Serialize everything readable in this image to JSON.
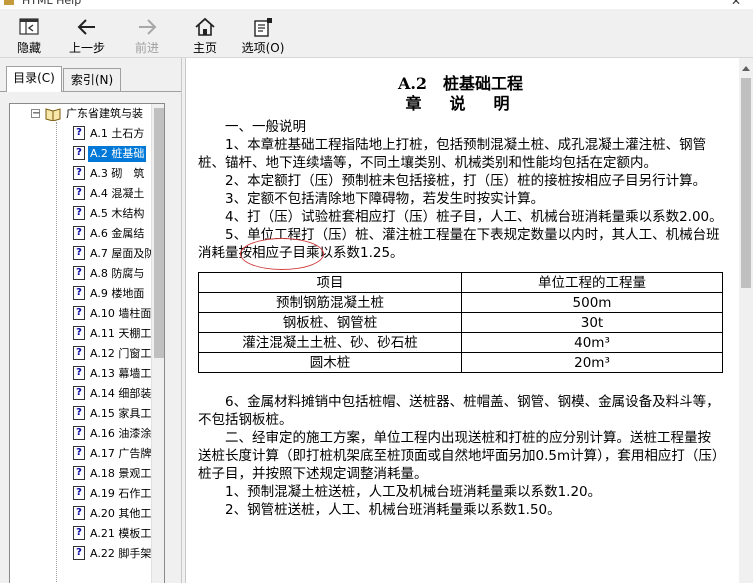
{
  "window": {
    "title": "HTML Help"
  },
  "toolbar": {
    "hide": "隐藏",
    "back": "上一步",
    "forward": "前进",
    "home": "主页",
    "options": "选项(O)"
  },
  "nav": {
    "tabs": [
      {
        "label": "目录(C)",
        "active": true
      },
      {
        "label": "索引(N)",
        "active": false
      }
    ],
    "root": {
      "label": "广东省建筑与装"
    },
    "items": [
      {
        "num": "A.1",
        "label": "土石方"
      },
      {
        "num": "A.2",
        "label": "桩基础",
        "selected": true
      },
      {
        "num": "A.3",
        "label": "砌　筑"
      },
      {
        "num": "A.4",
        "label": "混凝土"
      },
      {
        "num": "A.5",
        "label": "木结构"
      },
      {
        "num": "A.6",
        "label": "金属结"
      },
      {
        "num": "A.7",
        "label": "屋面及防"
      },
      {
        "num": "A.8",
        "label": "防腐与"
      },
      {
        "num": "A.9",
        "label": "楼地面"
      },
      {
        "num": "A.10",
        "label": "墙柱面"
      },
      {
        "num": "A.11",
        "label": "天棚工"
      },
      {
        "num": "A.12",
        "label": "门窗工"
      },
      {
        "num": "A.13",
        "label": "幕墙工"
      },
      {
        "num": "A.14",
        "label": "细部装"
      },
      {
        "num": "A.15",
        "label": "家具工"
      },
      {
        "num": "A.16",
        "label": "油漆涂"
      },
      {
        "num": "A.17",
        "label": "广告牌"
      },
      {
        "num": "A.18",
        "label": "景观工"
      },
      {
        "num": "A.19",
        "label": "石作工"
      },
      {
        "num": "A.20",
        "label": "其他工"
      },
      {
        "num": "A.21",
        "label": "模板工"
      },
      {
        "num": "A.22",
        "label": "脚手架"
      }
    ]
  },
  "content": {
    "title": "A.2　桩基础工程",
    "subtitle": "章　说　明",
    "section1": "一、一般说明",
    "paras": [
      "1、本章桩基础工程指陆地上打桩，包括预制混凝土桩、成孔混凝土灌注桩、钢管桩、锚杆、地下连续墙等，不同土壤类别、机械类别和性能均包括在定额内。",
      "2、本定额打（压）预制桩未包括接桩，打（压）桩的接桩按相应子目另行计算。",
      "3、定额不包括清除地下障碍物，若发生时按实计算。",
      "4、打（压）试验桩套相应打（压）桩子目，人工、机械台班消耗量乘以系数2.00。",
      "5、单位工程打（压）桩、灌注桩工程量在下表规定数量以内时，其人工、机械台班消耗量按相应子目乘以系数1.25。"
    ],
    "table": {
      "headers": [
        "项目",
        "单位工程的工程量"
      ],
      "rows": [
        [
          "预制钢筋混凝土桩",
          "500m"
        ],
        [
          "钢板桩、钢管桩",
          "30t"
        ],
        [
          "灌注混凝土土桩、砂、砂石桩",
          "40m³"
        ],
        [
          "圆木桩",
          "20m³"
        ]
      ]
    },
    "paras2": [
      "6、金属材料摊销中包括桩帽、送桩器、桩帽盖、钢管、钢模、金属设备及料斗等，不包括钢板桩。",
      "二、经审定的施工方案，单位工程内出现送桩和打桩的应分别计算。送桩工程量按送桩长度计算（即打桩机架底至桩顶面或自然地坪面另加0.5m计算），套用相应打（压）桩子目，并按照下述规定调整消耗量。",
      "1、预制混凝土桩送桩，人工及机械台班消耗量乘以系数1.20。",
      "2、钢管桩送桩，人工、机械台班消耗量乘以系数1.50。"
    ]
  }
}
